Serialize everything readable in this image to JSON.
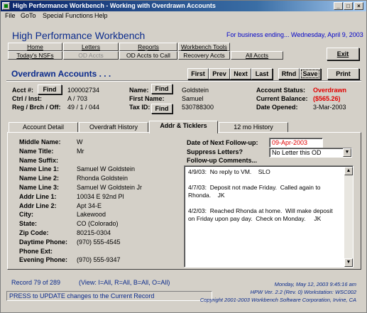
{
  "window": {
    "title": "High Performance Workbench - Working with Overdrawn Accounts"
  },
  "menu": [
    "File",
    "GoTo",
    "Special Functions",
    "Help"
  ],
  "header": {
    "title": "High Performance Workbench",
    "business": "For business ending... Wednesday, April 9, 2003"
  },
  "nav": {
    "home": "Home",
    "letters": "Letters",
    "reports": "Reports",
    "workbench_tools": "Workbench Tools",
    "todays_nsfs": "Today's NSFs",
    "od_accts": "OD Accts",
    "od_accts_to_call": "OD Accts to Call",
    "recovery_accts": "Recovery Accts",
    "all_accts": "All Accts",
    "exit": "Exit"
  },
  "section": {
    "title": "Overdrawn Accounts . . ."
  },
  "record_nav": {
    "first": "First",
    "prev": "Prev",
    "next": "Next",
    "last": "Last",
    "rfnd": "Rfnd",
    "save": "Save",
    "print": "Print"
  },
  "account": {
    "acct_label": "Acct #:",
    "find": "Find",
    "acct_no": "100002734",
    "ctrl_label": "Ctrl / Inst:",
    "ctrl_value": "A  /  703",
    "reg_label": "Reg / Brch / Off:",
    "reg_value": "49  /  1  /  044",
    "name_label": "Name:",
    "name_value": "Goldstein",
    "first_label": "First Name:",
    "first_value": "Samuel",
    "tax_label": "Tax ID:",
    "tax_value": "530788300",
    "status_label": "Account Status:",
    "status_value": "Overdrawn",
    "balance_label": "Current Balance:",
    "balance_value": "($565.26)",
    "opened_label": "Date Opened:",
    "opened_value": "3-Mar-2003"
  },
  "tabs": [
    "Account Detail",
    "Overdraft History",
    "Addr & Ticklers",
    "12 mo History"
  ],
  "address": [
    {
      "label": "Middle Name:",
      "value": "W"
    },
    {
      "label": "Name Title:",
      "value": "Mr"
    },
    {
      "label": "Name Suffix:",
      "value": ""
    },
    {
      "label": "Name Line 1:",
      "value": "Samuel W Goldstein"
    },
    {
      "label": "Name Line 2:",
      "value": "Rhonda Goldstein"
    },
    {
      "label": "Name Line 3:",
      "value": "Samuel W Goldstein Jr"
    },
    {
      "label": "Addr Line 1:",
      "value": "10034 E 92nd Pl"
    },
    {
      "label": "Addr Line 2:",
      "value": "Apt 34-E"
    },
    {
      "label": "City:",
      "value": "Lakewood"
    },
    {
      "label": "State:",
      "value": "CO  (Colorado)"
    },
    {
      "label": "Zip Code:",
      "value": "80215-0304"
    },
    {
      "label": "Daytime Phone:",
      "value": "(970) 555-4545"
    },
    {
      "label": "Phone Ext:",
      "value": ""
    },
    {
      "label": "Evening Phone:",
      "value": "(970) 555-9347"
    }
  ],
  "ticklers": {
    "next_followup_label": "Date of Next Follow-up:",
    "next_followup_value": "09-Apr-2003",
    "suppress_label": "Suppress Letters?",
    "suppress_value": "No Letter this OD",
    "comments_label": "Follow-up Comments...",
    "comments": [
      "4/9/03:  No reply to VM.    SLO",
      "4/7/03:  Deposit not made Friday.  Called again to Rhonda.    JK",
      "4/2/03:  Reached Rhonda at home.  Will make deposit on Friday upon pay day.  Check on Monday.     JK"
    ]
  },
  "footer": {
    "record": "Record  79  of  289",
    "view": "(View:  I=All, R=All, B=All, O=All)",
    "status_msg": "PRESS to UPDATE changes to the Current Record",
    "datetime": "Monday, May 12, 2003   9:45:16 am",
    "version": "HPW  Ver. 2.2  (Rev. 0)          Workstation: WSC002",
    "copyright": "Copyright 2001-2003   Workbench Software Corporation, Irvine, CA"
  },
  "colors": {
    "title_blue": "#0a2a8c",
    "alert_red": "#e00000",
    "titlebar": "#0a246a"
  }
}
